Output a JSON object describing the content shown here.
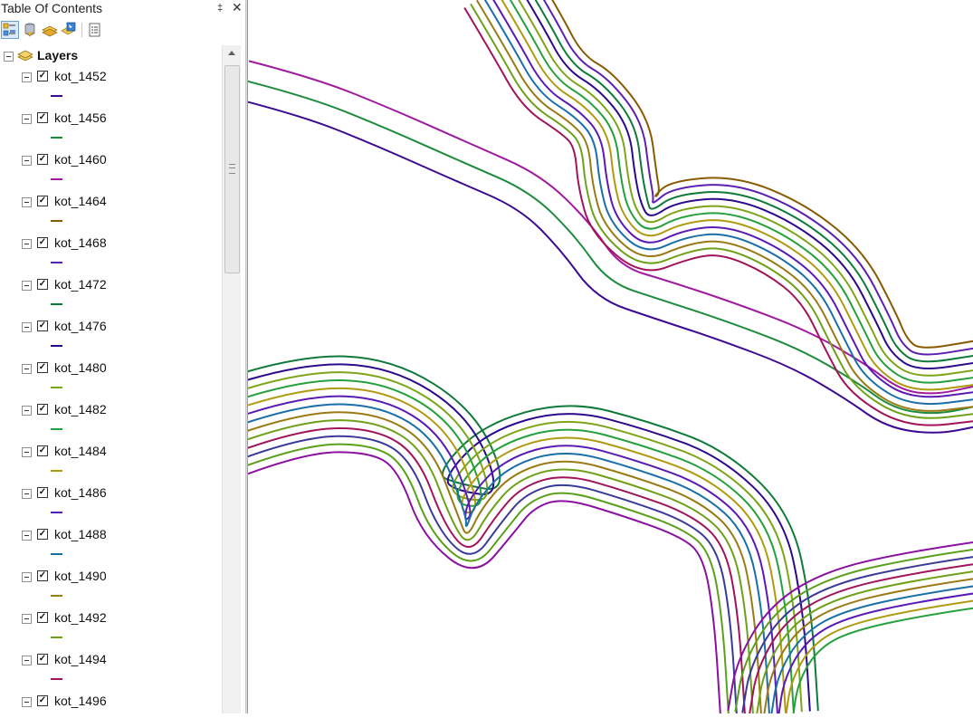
{
  "toc": {
    "title": "Table Of Contents",
    "pin_glyph": "‡",
    "close_glyph": "✕",
    "toolbar": [
      {
        "name": "list-by-drawing-order-icon",
        "active": true
      },
      {
        "name": "list-by-source-icon",
        "active": false
      },
      {
        "name": "list-by-visibility-icon",
        "active": false
      },
      {
        "name": "list-by-selection-icon",
        "active": false
      },
      {
        "name": "options-icon",
        "active": false
      }
    ],
    "root_label": "Layers",
    "layers": [
      {
        "name": "kot_1452",
        "checked": true,
        "color": "#3d0a91"
      },
      {
        "name": "kot_1456",
        "checked": true,
        "color": "#1e8c3c"
      },
      {
        "name": "kot_1460",
        "checked": true,
        "color": "#a01aa0"
      },
      {
        "name": "kot_1464",
        "checked": true,
        "color": "#8a5a00"
      },
      {
        "name": "kot_1468",
        "checked": true,
        "color": "#5a20b0"
      },
      {
        "name": "kot_1472",
        "checked": true,
        "color": "#0f7a3a"
      },
      {
        "name": "kot_1476",
        "checked": true,
        "color": "#2d0a8c"
      },
      {
        "name": "kot_1480",
        "checked": true,
        "color": "#7da51a"
      },
      {
        "name": "kot_1482",
        "checked": true,
        "color": "#25a03c"
      },
      {
        "name": "kot_1484",
        "checked": true,
        "color": "#b09a10"
      },
      {
        "name": "kot_1486",
        "checked": true,
        "color": "#5a1ab4"
      },
      {
        "name": "kot_1488",
        "checked": true,
        "color": "#1a6fa8"
      },
      {
        "name": "kot_1490",
        "checked": true,
        "color": "#9a7a14"
      },
      {
        "name": "kot_1492",
        "checked": true,
        "color": "#6fa01a"
      },
      {
        "name": "kot_1494",
        "checked": true,
        "color": "#a0145a"
      },
      {
        "name": "kot_1496",
        "checked": true,
        "color": "#3a3a9a"
      }
    ]
  },
  "map": {
    "palette": [
      "#3d0a91",
      "#1e8c3c",
      "#a01aa0",
      "#8a5a00",
      "#5a20b0",
      "#0f7a3a",
      "#2d0a8c",
      "#7da51a",
      "#25a03c",
      "#b09a10",
      "#5a1ab4",
      "#1a6fa8",
      "#9a7a14",
      "#6fa01a",
      "#a0145a",
      "#3a3a9a",
      "#5aa01a",
      "#8a10a0"
    ]
  }
}
